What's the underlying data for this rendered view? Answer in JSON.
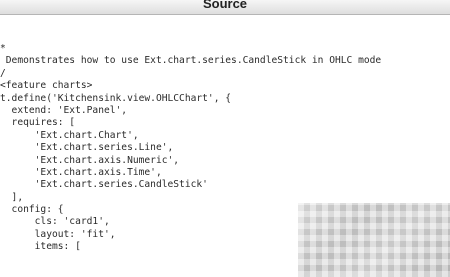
{
  "window": {
    "title": "Source"
  },
  "code": {
    "lines": [
      "*",
      " Demonstrates how to use Ext.chart.series.CandleStick in OHLC mode",
      "/",
      "<feature charts>",
      "t.define('Kitchensink.view.OHLCChart', {",
      "  extend: 'Ext.Panel',",
      "  requires: [",
      "      'Ext.chart.Chart',",
      "      'Ext.chart.series.Line',",
      "      'Ext.chart.axis.Numeric',",
      "      'Ext.chart.axis.Time',",
      "      'Ext.chart.series.CandleStick'",
      "  ],",
      "  config: {",
      "      cls: 'card1',",
      "      layout: 'fit',",
      "      items: ["
    ]
  },
  "preview": {
    "icon": "blurred-chart-thumbnail"
  }
}
